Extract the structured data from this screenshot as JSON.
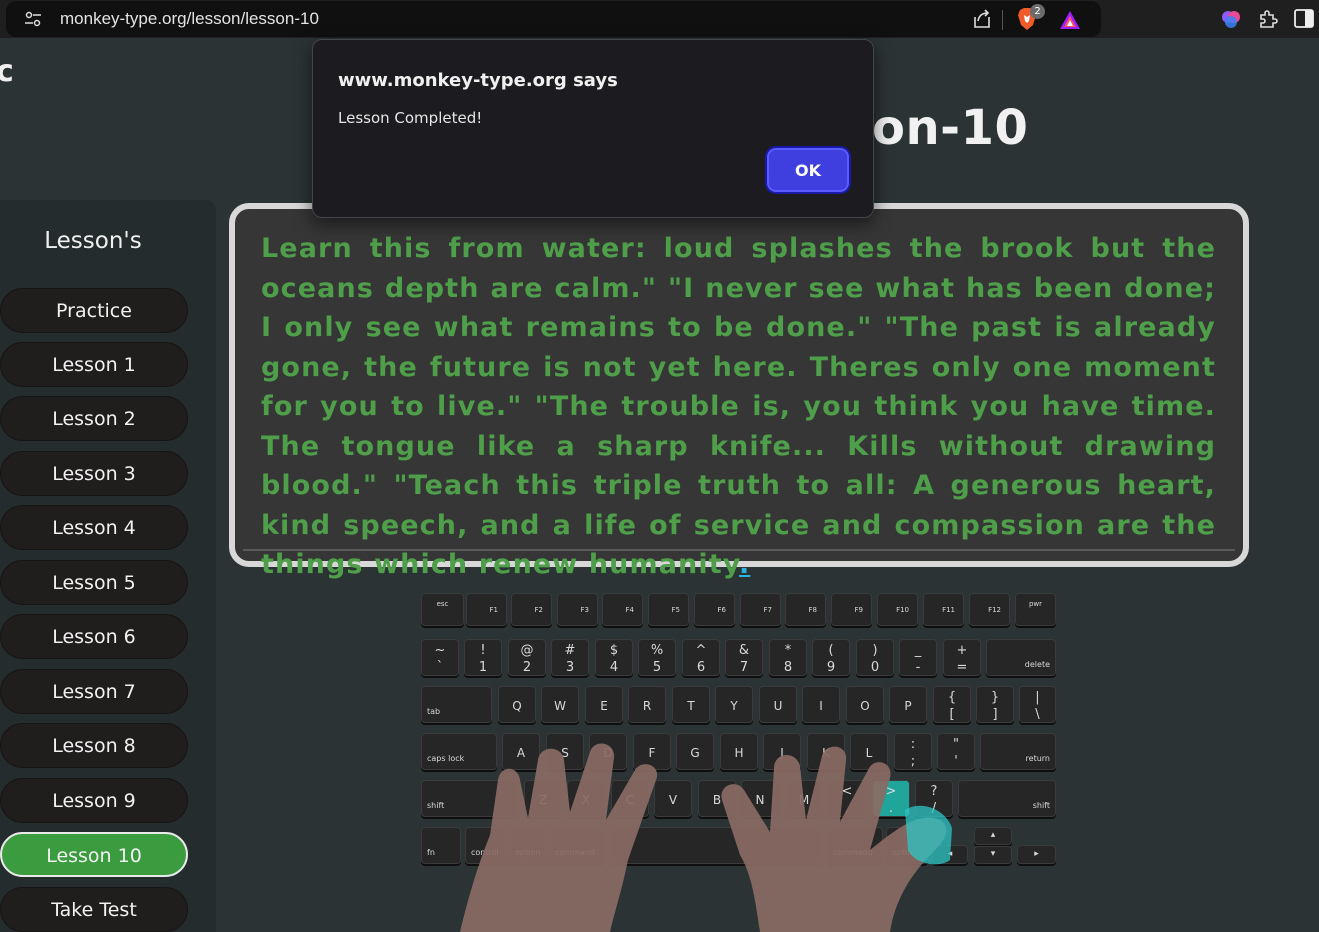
{
  "browser": {
    "url": "monkey-type.org/lesson/lesson-10",
    "brave_badge_count": "2"
  },
  "dialog": {
    "origin": "www.monkey-type.org says",
    "message": "Lesson Completed!",
    "ok_label": "OK"
  },
  "page": {
    "corner_glyph": "c",
    "title_visible": "on-10"
  },
  "sidebar": {
    "title": "Lesson's",
    "items": [
      {
        "label": "Practice"
      },
      {
        "label": "Lesson 1"
      },
      {
        "label": "Lesson 2"
      },
      {
        "label": "Lesson 3"
      },
      {
        "label": "Lesson 4"
      },
      {
        "label": "Lesson 5"
      },
      {
        "label": "Lesson 6"
      },
      {
        "label": "Lesson 7"
      },
      {
        "label": "Lesson 8"
      },
      {
        "label": "Lesson 9"
      },
      {
        "label": "Lesson 10"
      },
      {
        "label": "Take Test"
      }
    ],
    "active_index": 10
  },
  "lesson": {
    "text": "Learn this from water: loud splashes the brook but the oceans depth are calm.\" \"I never see what has been done; I only see what remains to be done.\" \"The past is already gone, the future is not yet here. Theres only one moment for you to live.\" \"The trouble is, you think you have time. The tongue like a sharp knife... Kills without drawing blood.\" \"Teach this triple truth to all: A generous heart, kind speech, and a life of service and compassion are the things which renew humanity",
    "cursor_char": ".",
    "colors": {
      "typed": "#4e9e4a",
      "cursor": "#2bb3e0"
    }
  },
  "keyboard": {
    "fn_row": [
      "esc",
      "F1",
      "F2",
      "F3",
      "F4",
      "F5",
      "F6",
      "F7",
      "F8",
      "F9",
      "F10",
      "F11",
      "F12",
      "pwr"
    ],
    "number_row": [
      {
        "top": "~",
        "bot": "`"
      },
      {
        "top": "!",
        "bot": "1"
      },
      {
        "top": "@",
        "bot": "2"
      },
      {
        "top": "#",
        "bot": "3"
      },
      {
        "top": "$",
        "bot": "4"
      },
      {
        "top": "%",
        "bot": "5"
      },
      {
        "top": "^",
        "bot": "6"
      },
      {
        "top": "&",
        "bot": "7"
      },
      {
        "top": "*",
        "bot": "8"
      },
      {
        "top": "(",
        "bot": "9"
      },
      {
        "top": ")",
        "bot": "0"
      },
      {
        "top": "_",
        "bot": "-"
      },
      {
        "top": "+",
        "bot": "="
      }
    ],
    "delete": "delete",
    "tab": "tab",
    "q_row": [
      "Q",
      "W",
      "E",
      "R",
      "T",
      "Y",
      "U",
      "I",
      "O",
      "P"
    ],
    "bracket_keys": [
      {
        "top": "{",
        "bot": "["
      },
      {
        "top": "}",
        "bot": "]"
      },
      {
        "top": "|",
        "bot": "\\"
      }
    ],
    "caps": "caps lock",
    "a_row": [
      "A",
      "S",
      "D",
      "F",
      "G",
      "H",
      "J",
      "K",
      "L"
    ],
    "semicolon_keys": [
      {
        "top": ":",
        "bot": ";"
      },
      {
        "top": "\"",
        "bot": "'"
      }
    ],
    "return": "return",
    "shift_left": "shift",
    "z_row": [
      "Z",
      "X",
      "C",
      "V",
      "B",
      "N",
      "M"
    ],
    "punct_keys": [
      {
        "top": "<",
        "bot": ","
      },
      {
        "top": ">",
        "bot": "."
      },
      {
        "top": "?",
        "bot": "/"
      }
    ],
    "shift_right": "shift",
    "fn": "fn",
    "control": "control",
    "option_left": "option",
    "command_left": "command",
    "command_right": "command",
    "option_right": "option",
    "arrow_left": "◂",
    "arrow_up": "▴",
    "arrow_down": "▾",
    "arrow_right": "▸",
    "highlight_key": ">",
    "highlight_color": "#1fa59a"
  }
}
